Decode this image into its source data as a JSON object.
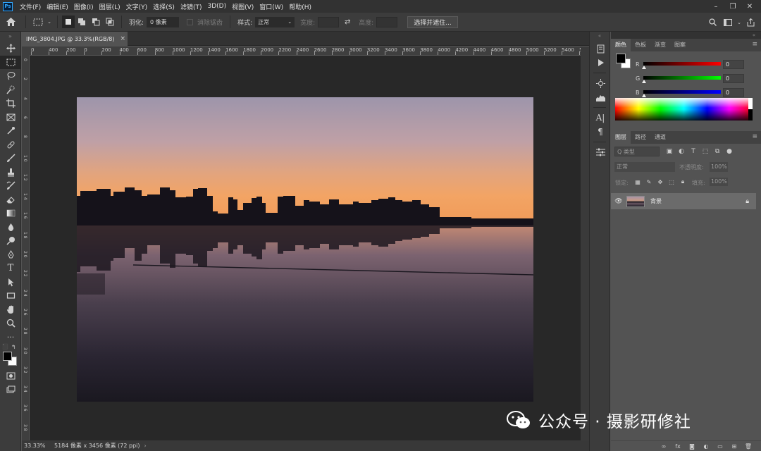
{
  "app": {
    "logo_text": "Ps"
  },
  "menu": {
    "items": [
      "文件(F)",
      "编辑(E)",
      "图像(I)",
      "图层(L)",
      "文字(Y)",
      "选择(S)",
      "滤镜(T)",
      "3D(D)",
      "视图(V)",
      "窗口(W)",
      "帮助(H)"
    ]
  },
  "options": {
    "feather_label": "羽化:",
    "feather_value": "0 像素",
    "antialias_label": "消除锯齿",
    "style_label": "样式:",
    "style_value": "正常",
    "width_label": "宽度:",
    "height_label": "高度:",
    "select_mask_button": "选择并遮住..."
  },
  "document": {
    "tab_title": "IMG_3804.JPG @ 33.3%(RGB/8)",
    "tab_close": "×",
    "ruler_h_labels": [
      "0",
      "400",
      "200",
      "0",
      "200",
      "400",
      "600",
      "800",
      "1000",
      "1200",
      "1400",
      "1600",
      "1800",
      "2000",
      "2200",
      "2400",
      "2600",
      "2800",
      "3000",
      "3200",
      "3400",
      "3600",
      "3800",
      "4000",
      "4200",
      "4400",
      "4600",
      "4800",
      "5000",
      "5200",
      "5400",
      "560"
    ],
    "ruler_v_labels": [
      "0",
      "2",
      "4",
      "6",
      "8",
      "1 0",
      "1 2",
      "1 4",
      "1 6",
      "1 8",
      "2 0",
      "2 2",
      "2 4",
      "2 6",
      "2 8",
      "3 0",
      "3 2",
      "3 4",
      "3 6",
      "3 8"
    ]
  },
  "status": {
    "zoom": "33.33%",
    "doc_info": "5184 像素 x 3456 像素 (72 ppi)",
    "arrow": "›"
  },
  "panels": {
    "color_tabs": [
      "颜色",
      "色板",
      "渐变",
      "图案"
    ],
    "channels": [
      {
        "label": "R",
        "value": "0",
        "gradient": "#ff0000"
      },
      {
        "label": "G",
        "value": "0",
        "gradient": "#00ff00"
      },
      {
        "label": "B",
        "value": "0",
        "gradient": "#0000ff"
      }
    ],
    "layers_tabs": [
      "图层",
      "路径",
      "通道"
    ],
    "layer_search": "Q 类型",
    "blend_mode": "正常",
    "opacity_label": "不透明度:",
    "opacity_value": "100%",
    "lock_label": "锁定:",
    "fill_label": "填充:",
    "fill_value": "100%",
    "layer_name": "背景"
  },
  "watermark": {
    "text": "公众号 · 摄影研修社"
  },
  "colors": {
    "accent": "#31a8ff",
    "canvas_bg": "#282828",
    "panel_bg": "#535353"
  }
}
